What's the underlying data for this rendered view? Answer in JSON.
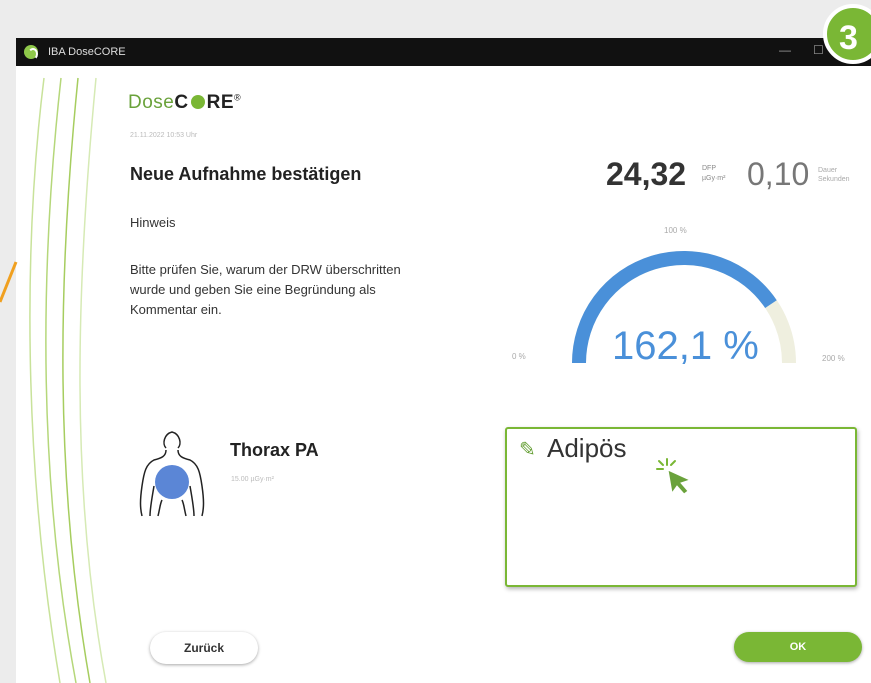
{
  "window": {
    "title": "IBA DoseCORE",
    "minimize_glyph": "—",
    "maximize_glyph": "☐"
  },
  "step_badge": "3",
  "logo": {
    "prefix": "Dose",
    "c": "C",
    "suffix": "RE",
    "mark": "®"
  },
  "subline": "21.11.2022 10:53 Uhr",
  "heading": "Neue Aufnahme bestätigen",
  "hint": {
    "title": "Hinweis",
    "lines": [
      "Bitte prüfen Sie, warum der DRW überschritten",
      "wurde und geben Sie eine Begründung als",
      "Kommentar ein."
    ]
  },
  "dose": {
    "value": "24,32",
    "unit_top": "DFP",
    "unit_bottom": "µGy·m²"
  },
  "time": {
    "value": "0,10",
    "unit_top": "Dauer",
    "unit_bottom": "Sekunden"
  },
  "gauge": {
    "label_top": "100 %",
    "label_left": "0 %",
    "label_right": "200 %",
    "percent_text": "162,1 %",
    "percent_value": 162.1,
    "max": 200,
    "fill_color": "#4a90d9",
    "track_color": "#efefdf"
  },
  "exam": {
    "title": "Thorax PA",
    "reference_dose": "15.00 µGy·m²"
  },
  "comment": {
    "text": "Adipös",
    "icon": "pencil-icon"
  },
  "buttons": {
    "back": "Zurück",
    "ok": "OK"
  },
  "colors": {
    "accent": "#7ab735",
    "gauge_blue": "#4a90d9"
  }
}
